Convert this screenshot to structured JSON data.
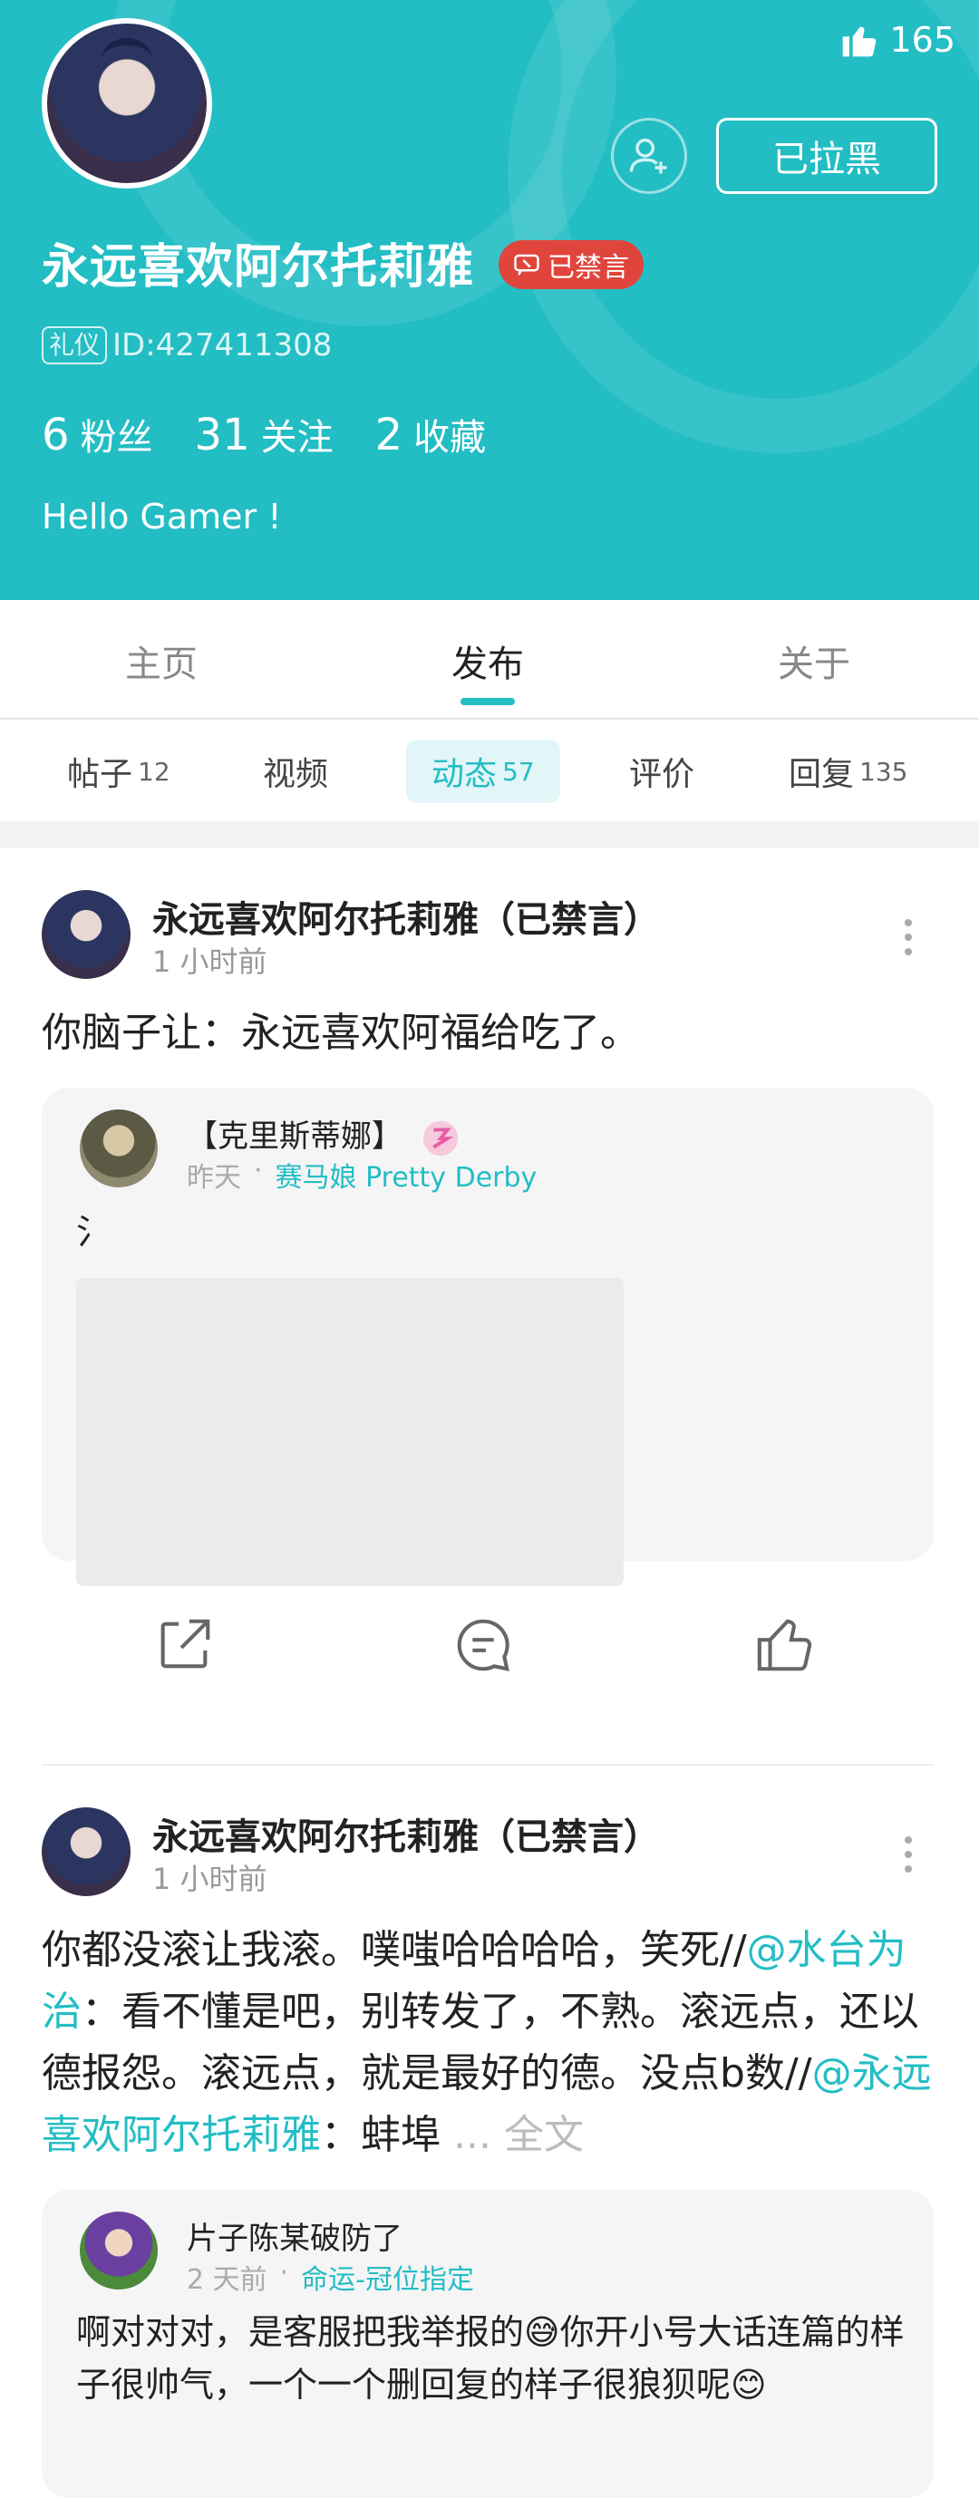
{
  "profile": {
    "like_count": "165",
    "blocked_label": "已拉黑",
    "username": "永远喜欢阿尔托莉雅",
    "muted_badge": "已禁言",
    "etiquette_label": "礼仪",
    "id_text": "ID:427411308",
    "stats": [
      {
        "num": "6",
        "label": "粉丝"
      },
      {
        "num": "31",
        "label": "关注"
      },
      {
        "num": "2",
        "label": "收藏"
      }
    ],
    "bio": "Hello Gamer !"
  },
  "main_tabs": [
    {
      "label": "主页"
    },
    {
      "label": "发布"
    },
    {
      "label": "关于"
    }
  ],
  "sub_tabs": [
    {
      "label": "帖子",
      "count": "12"
    },
    {
      "label": "视频",
      "count": ""
    },
    {
      "label": "动态",
      "count": "57"
    },
    {
      "label": "评价",
      "count": ""
    },
    {
      "label": "回复",
      "count": "135"
    }
  ],
  "posts": [
    {
      "author": "永远喜欢阿尔托莉雅（已禁言）",
      "time": "1 小时前",
      "text": "你脑子让：永远喜欢阿福给吃了。",
      "quote": {
        "name": "【克里斯蒂娜】",
        "time": "昨天",
        "sep": "·",
        "tag": "赛马娘 Pretty Derby",
        "text": "氵"
      }
    },
    {
      "author": "永远喜欢阿尔托莉雅（已禁言）",
      "time": "1 小时前",
      "text_parts": {
        "a": "你都没滚让我滚。噗嗤哈哈哈哈，笑死//",
        "m1": "@水台为治",
        "b": "：看不懂是吧，别转发了，不熟。滚远点，还以德报怨。滚远点，就是最好的德。没点b数//",
        "m2": "@永远喜欢阿尔托莉雅",
        "c": "：蚌埠 ",
        "more": "... 全文"
      },
      "quote": {
        "name": "片子陈某破防了",
        "time": "2 天前",
        "sep": "·",
        "tag": "命运-冠位指定",
        "text": "啊对对对，是客服把我举报的😅你开小号大话连篇的样子很帅气，一个一个删回复的样子很狼狈呢😊"
      }
    }
  ],
  "colors": {
    "accent": "#23bdc4",
    "muted_red": "#e0453b"
  }
}
